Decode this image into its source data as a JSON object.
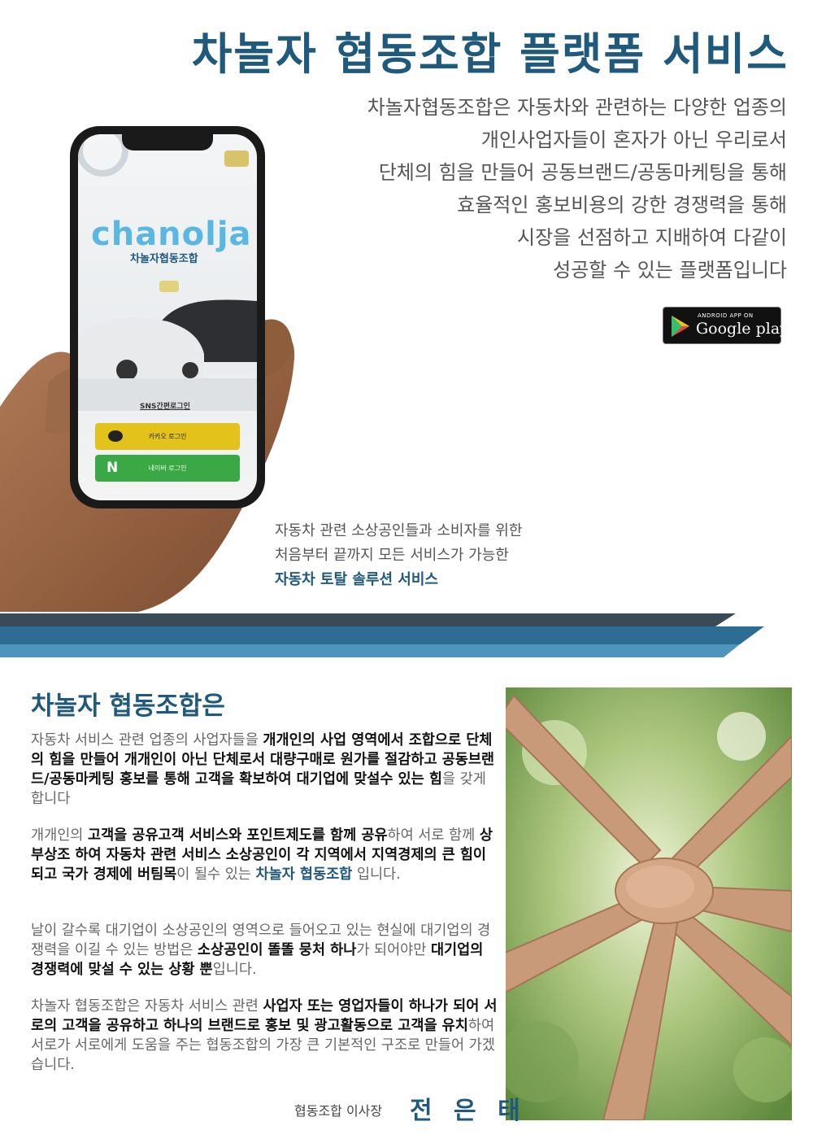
{
  "header": {
    "title": "차놀자 협동조합 플랫폼 서비스",
    "intro_lines": [
      "차놀자협동조합은 자동차와 관련하는 다양한 업종의",
      "개인사업자들이 혼자가 아닌 우리로서",
      "단체의 힘을 만들어 공동브랜드/공동마케팅을 통해",
      "효율적인 홍보비용의 강한 경쟁력을 통해",
      "시장을 선점하고 지배하여 다같이",
      "성공할 수 있는 플랫폼입니다"
    ]
  },
  "store_badge": {
    "small": "ANDROID APP ON",
    "big": "Google play"
  },
  "phone": {
    "logo": "chanolja",
    "logo_sub": "차놀자협동조합",
    "sns_label": "SNS간편로그인",
    "kakao_label": "카카오 로그인",
    "naver_label": "네이버 로그인",
    "naver_icon": "N"
  },
  "tagline": {
    "line1": "자동차 관련 소상공인들과 소비자를 위한",
    "line2": "처음부터 끝까지 모든 서비스가 가능한",
    "line3": "자동차 토탈 솔루션 서비스"
  },
  "about": {
    "title": "차놀자 협동조합은",
    "p1": [
      {
        "t": "자동차 서비스 관련 업종의 사업자들을 ",
        "s": "n"
      },
      {
        "t": "개개인의 사업 영역에서 조합으로 단체의 힘을 만들어 개개인이 아닌 단체로서 대량구매로 원가를 절감하고 공동브랜드/공동마케팅 홍보를 통해 고객을 확보하여 대기업에 맞설수 있는 힘",
        "s": "b"
      },
      {
        "t": "을 갖게 합니다",
        "s": "n"
      }
    ],
    "p2": [
      {
        "t": "개개인의 ",
        "s": "n"
      },
      {
        "t": "고객을 공유고객 서비스와 포인트제도를 함께 공유",
        "s": "b"
      },
      {
        "t": "하여 서로 함께 ",
        "s": "n"
      },
      {
        "t": "상부상조 하여 자동차 관련 서비스 소상공인이 각 지역에서 지역경제의 큰 힘이 되고 국가 경제에 버팀목",
        "s": "b"
      },
      {
        "t": "이 될수 있는 ",
        "s": "n"
      },
      {
        "t": "차놀자 협동조합",
        "s": "a"
      },
      {
        "t": " 입니다.",
        "s": "n"
      }
    ],
    "p3": [
      {
        "t": "날이 갈수록 대기업이 소상공인의 영역으로 들어오고 있는 현실에 대기업의 경쟁력을 이길 수 있는 방법은 ",
        "s": "n"
      },
      {
        "t": "소상공인이 똘똘 뭉처 하나",
        "s": "b"
      },
      {
        "t": "가 되어야만 ",
        "s": "n"
      },
      {
        "t": "대기업의 경쟁력에 맞설 수 있는 상황 뿐",
        "s": "b"
      },
      {
        "t": "입니다.",
        "s": "n"
      }
    ],
    "p4": [
      {
        "t": "차놀자 협동조합은 자동차 서비스 관련 ",
        "s": "n"
      },
      {
        "t": "사업자 또는 영업자들이 하나가 되어 서로의 고객을 공유하고 하나의 브랜드로 홍보 및 광고활동으로 고객을 유치",
        "s": "b"
      },
      {
        "t": "하여 서로가 서로에게 도움을 주는 협동조합의 가장 큰 기본적인 구조로 만들어 가겠습니다.",
        "s": "n"
      }
    ]
  },
  "signature": {
    "label": "협동조합 이사장",
    "name": "전 은 태"
  },
  "colors": {
    "brand": "#1f5a7d",
    "band_dark": "#3a4a57",
    "band_mid": "#2d6d93",
    "band_light": "#4f94bd"
  },
  "icons": [
    "google-play-icon",
    "kakao-chat-icon",
    "naver-n-icon"
  ]
}
